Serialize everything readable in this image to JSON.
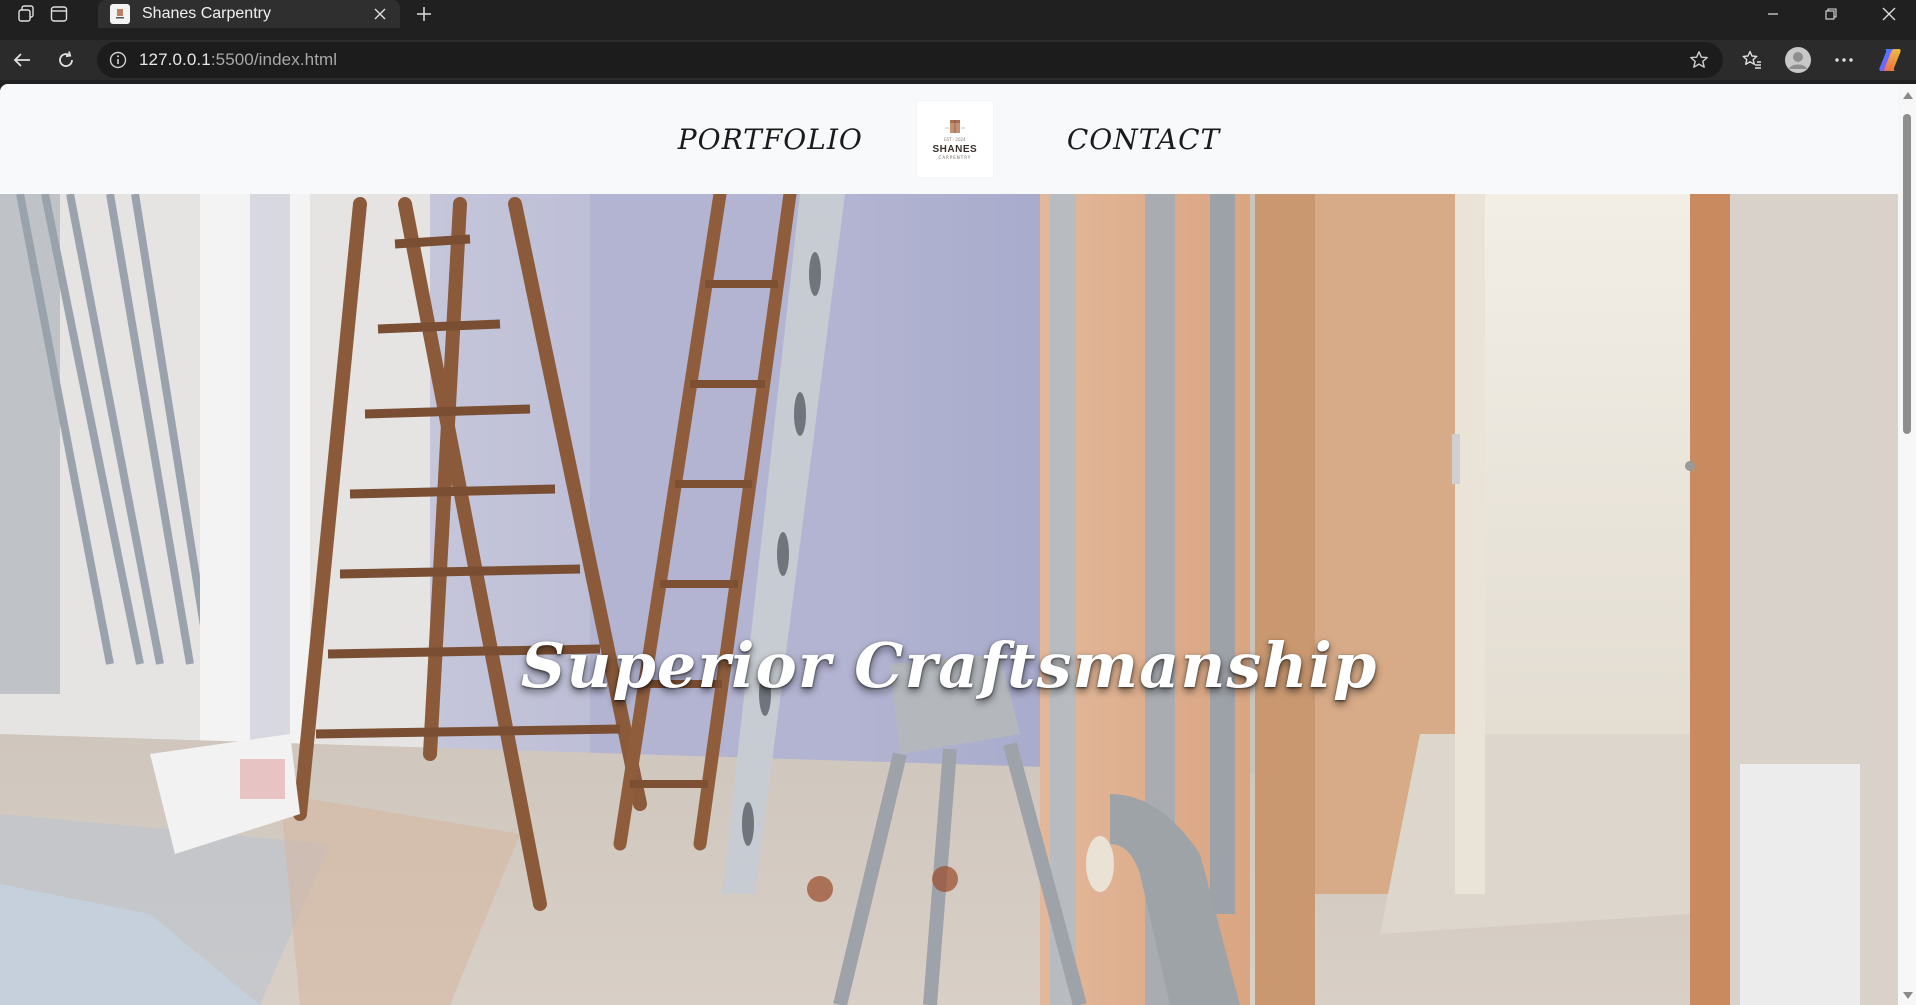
{
  "browser": {
    "tab_title": "Shanes Carpentry",
    "url_host": "127.0.0.1",
    "url_rest": ":5500/index.html"
  },
  "site": {
    "nav": {
      "left_link": "PORTFOLIO",
      "right_link": "CONTACT",
      "logo": {
        "top_text": "EST · 2024",
        "name": "SHANES",
        "sub": "CARPENTRY"
      }
    },
    "hero": {
      "title": "Superior Craftsmanship"
    }
  },
  "colors": {
    "nav_bg": "#f8f9fa",
    "hero_text": "#ffffff",
    "chrome_bg": "#202020"
  }
}
